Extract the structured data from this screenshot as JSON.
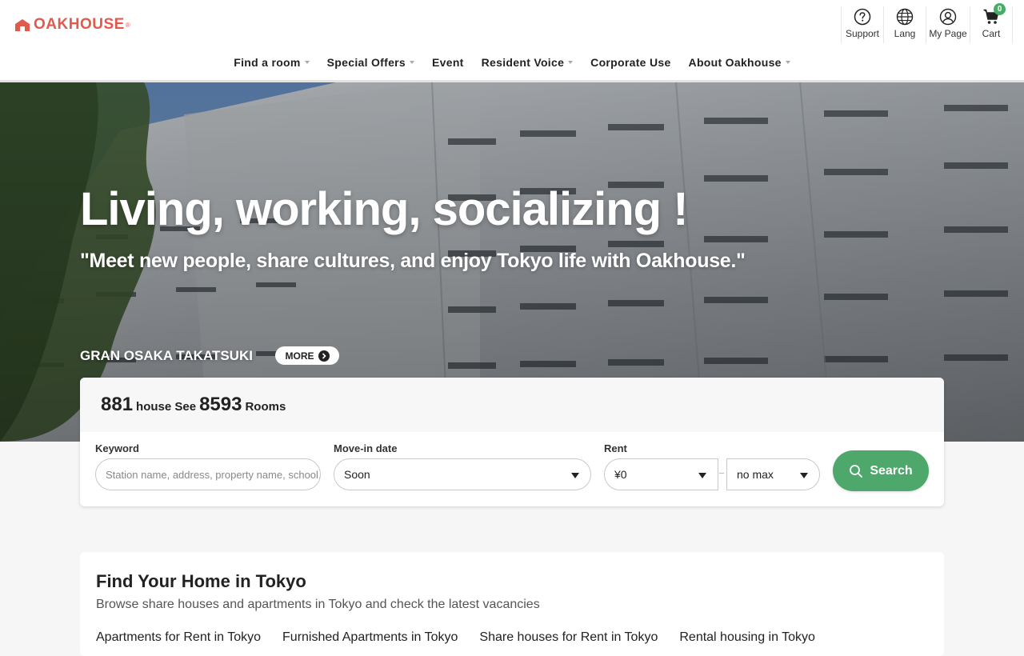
{
  "header": {
    "logo_text": "OAKHOUSE",
    "logo_reg": "®",
    "utilities": [
      {
        "label": "Support",
        "icon": "question-circle-icon"
      },
      {
        "label": "Lang",
        "icon": "globe-icon"
      },
      {
        "label": "My Page",
        "icon": "user-icon"
      },
      {
        "label": "Cart",
        "icon": "cart-icon",
        "badge": "0"
      }
    ],
    "nav": [
      {
        "label": "Find a room",
        "dropdown": true
      },
      {
        "label": "Special Offers",
        "dropdown": true
      },
      {
        "label": "Event",
        "dropdown": false
      },
      {
        "label": "Resident Voice",
        "dropdown": true
      },
      {
        "label": "Corporate Use",
        "dropdown": false
      },
      {
        "label": "About Oakhouse",
        "dropdown": true
      }
    ]
  },
  "hero": {
    "title": "Living, working, socializing !",
    "subtitle": "\"Meet new people, share cultures, and enjoy Tokyo life with Oakhouse.\"",
    "property_name": "GRAN OSAKA TAKATSUKI",
    "more_label": "MORE"
  },
  "search": {
    "house_count": "881",
    "house_text": "house See",
    "room_count": "8593",
    "room_text": "Rooms",
    "keyword_label": "Keyword",
    "keyword_placeholder": "Station name, address, property name, school...",
    "movein_label": "Move-in date",
    "movein_value": "Soon",
    "rent_label": "Rent",
    "rent_min": "¥0",
    "rent_max": "no max",
    "search_label": "Search"
  },
  "home_section": {
    "title": "Find Your Home in Tokyo",
    "subtitle": "Browse share houses and apartments in Tokyo and check the latest vacancies",
    "links": [
      "Apartments for Rent in Tokyo",
      "Furnished Apartments in Tokyo",
      "Share houses for Rent in Tokyo",
      "Rental housing in Tokyo"
    ]
  },
  "colors": {
    "brand": "#e05a4e",
    "search_button": "#4ea86c",
    "cart_badge": "#4aaa6a"
  }
}
